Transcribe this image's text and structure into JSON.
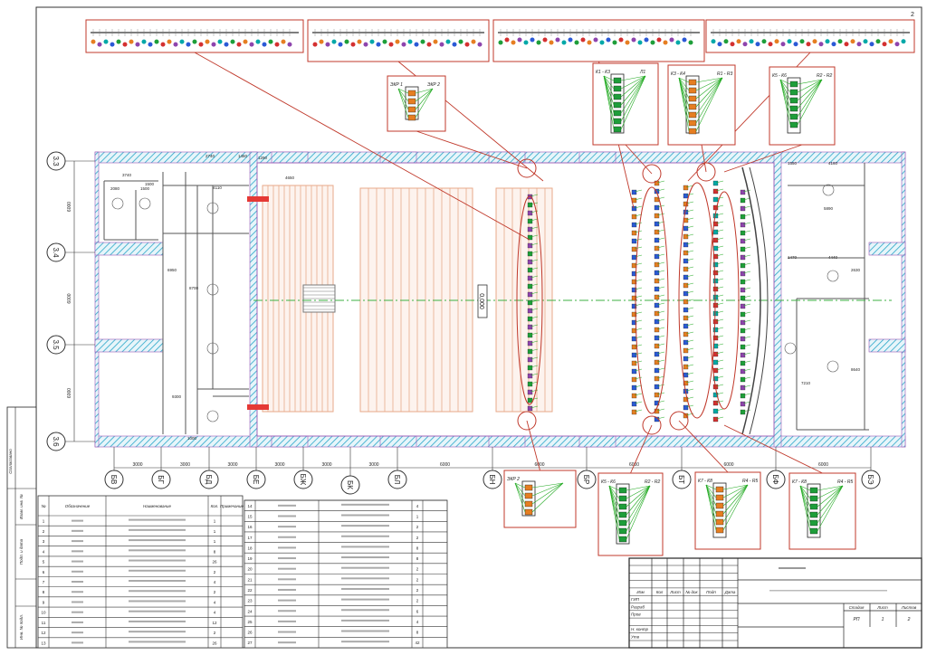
{
  "sheet_number": "2",
  "elevation_mark": "0,000",
  "axes_rows": [
    "3.3",
    "3.4",
    "3.5",
    "3.6"
  ],
  "axes_columns": [
    "БВ",
    "БГ",
    "БД",
    "БЕ",
    "БЖ",
    "БК",
    "БЛ",
    "БН",
    "БР",
    "БТ",
    "БФ",
    "БЭ"
  ],
  "column_dimensions": [
    "3000",
    "3000",
    "3000",
    "3000",
    "3000",
    "3000",
    "6000",
    "6000",
    "6000",
    "6000",
    "6000"
  ],
  "row_dimensions": [
    "6000",
    "6000",
    "6000"
  ],
  "left_rooms_dimensions": [
    "2740",
    "1460",
    "1290",
    "3740",
    "2080",
    "1500",
    "1500",
    "4110",
    "8700",
    "6950",
    "9300",
    "1000",
    "4650"
  ],
  "right_rooms_dimensions": [
    "1550",
    "4160",
    "5890",
    "1470",
    "4440",
    "7210",
    "8640",
    "2630"
  ],
  "callout_labels": [
    "К1 - К3",
    "Л1",
    "К3 - К4",
    "R1 - R3",
    "К5 - К6",
    "R2 - R2",
    "К7 - К8",
    "R4 - R5",
    "ЭКР 1",
    "ЭКР 2"
  ],
  "stamp": {
    "approved": "Согласовано",
    "replace_inv": "Взам. инв. №",
    "sign_date": "Подп. и дата",
    "inv_orig": "Инв. № подл."
  },
  "spec_table_left": {
    "headers": [
      "№",
      "Обозначение",
      "Наименование",
      "Кол.",
      "Примечание"
    ],
    "rows": [
      {
        "n": "1",
        "qty": "1"
      },
      {
        "n": "2",
        "qty": "1"
      },
      {
        "n": "3",
        "qty": "1"
      },
      {
        "n": "4",
        "qty": "8"
      },
      {
        "n": "5",
        "qty": "26"
      },
      {
        "n": "6",
        "qty": "2"
      },
      {
        "n": "7",
        "qty": "4"
      },
      {
        "n": "8",
        "qty": "2"
      },
      {
        "n": "9",
        "qty": "4"
      },
      {
        "n": "10",
        "qty": "4"
      },
      {
        "n": "11",
        "qty": "12"
      },
      {
        "n": "12",
        "qty": "2"
      },
      {
        "n": "13",
        "qty": "26"
      }
    ]
  },
  "spec_table_right": {
    "rows": [
      {
        "n": "14",
        "qty": "4"
      },
      {
        "n": "15",
        "qty": "1"
      },
      {
        "n": "16",
        "qty": "2"
      },
      {
        "n": "17",
        "qty": "2"
      },
      {
        "n": "18",
        "qty": "8"
      },
      {
        "n": "19",
        "qty": "8"
      },
      {
        "n": "20",
        "qty": "2"
      },
      {
        "n": "21",
        "qty": "2"
      },
      {
        "n": "22",
        "qty": "2"
      },
      {
        "n": "23",
        "qty": "2"
      },
      {
        "n": "24",
        "qty": "6"
      },
      {
        "n": "25",
        "qty": "4"
      },
      {
        "n": "26",
        "qty": "8"
      },
      {
        "n": "27",
        "qty": "42"
      }
    ]
  },
  "title_block": {
    "cols": [
      "Изм",
      "Кол",
      "Лист",
      "№ док",
      "Подп",
      "Дата"
    ],
    "roles": [
      "ГИП",
      "Разраб",
      "Пров",
      "",
      "Н. контр",
      "Утв"
    ],
    "stage_label": "Стадия",
    "sheet_label": "Лист",
    "sheets_label": "Листов",
    "stage": "РП",
    "sheet": "1",
    "sheets": "2"
  },
  "colors": {
    "wall_hatch": "#2aa7c9",
    "callout_frame": "#c0392b",
    "risers": "#e8a98a",
    "axis_line": "#3cb043",
    "outline": "#9b59b6"
  }
}
